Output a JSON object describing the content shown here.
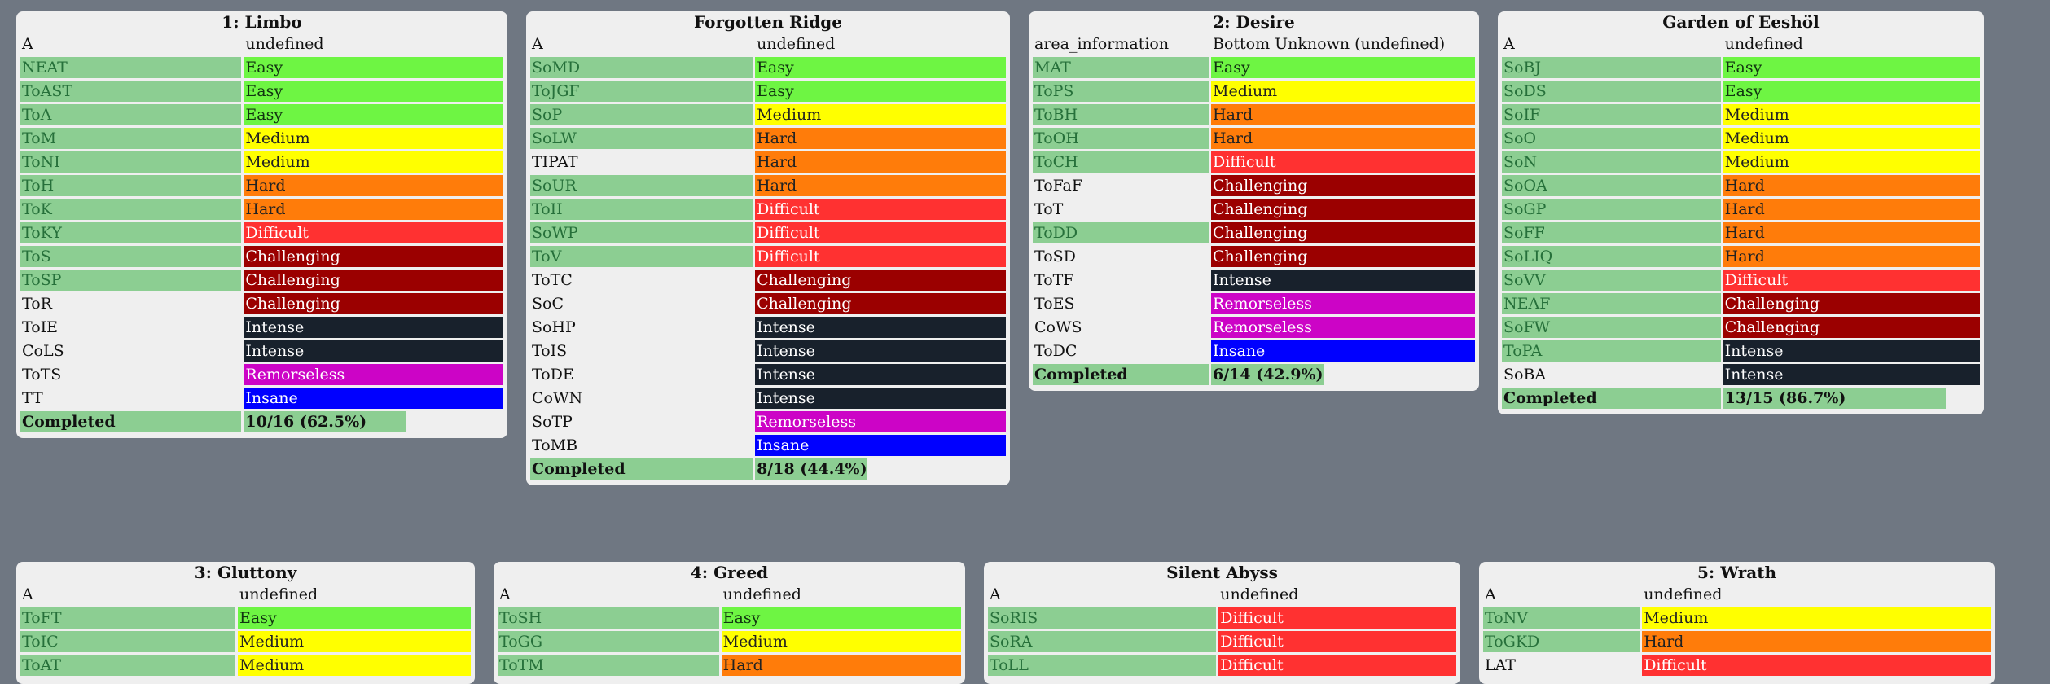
{
  "panels": [
    {
      "id": "limbo",
      "title": "1: Limbo",
      "header": [
        "A",
        "undefined"
      ],
      "rows": [
        {
          "name": "NEAT",
          "difficulty": "Easy",
          "done": true
        },
        {
          "name": "ToAST",
          "difficulty": "Easy",
          "done": true
        },
        {
          "name": "ToA",
          "difficulty": "Easy",
          "done": true
        },
        {
          "name": "ToM",
          "difficulty": "Medium",
          "done": true
        },
        {
          "name": "ToNI",
          "difficulty": "Medium",
          "done": true
        },
        {
          "name": "ToH",
          "difficulty": "Hard",
          "done": true
        },
        {
          "name": "ToK",
          "difficulty": "Hard",
          "done": true
        },
        {
          "name": "ToKY",
          "difficulty": "Difficult",
          "done": true
        },
        {
          "name": "ToS",
          "difficulty": "Challenging",
          "done": true
        },
        {
          "name": "ToSP",
          "difficulty": "Challenging",
          "done": true
        },
        {
          "name": "ToR",
          "difficulty": "Challenging",
          "done": false
        },
        {
          "name": "ToIE",
          "difficulty": "Intense",
          "done": false
        },
        {
          "name": "CoLS",
          "difficulty": "Intense",
          "done": false
        },
        {
          "name": "ToTS",
          "difficulty": "Remorseless",
          "done": false
        },
        {
          "name": "TT",
          "difficulty": "Insane",
          "done": false
        }
      ],
      "completed_label": "Completed",
      "completed_text": "10/16 (62.5%)",
      "completed_fraction": 0.625
    },
    {
      "id": "forgotten-ridge",
      "title": "Forgotten Ridge",
      "header": [
        "A",
        "undefined"
      ],
      "rows": [
        {
          "name": "SoMD",
          "difficulty": "Easy",
          "done": true
        },
        {
          "name": "ToJGF",
          "difficulty": "Easy",
          "done": true
        },
        {
          "name": "SoP",
          "difficulty": "Medium",
          "done": true
        },
        {
          "name": "SoLW",
          "difficulty": "Hard",
          "done": true
        },
        {
          "name": "TIPAT",
          "difficulty": "Hard",
          "done": false
        },
        {
          "name": "SoUR",
          "difficulty": "Hard",
          "done": true
        },
        {
          "name": "ToII",
          "difficulty": "Difficult",
          "done": true
        },
        {
          "name": "SoWP",
          "difficulty": "Difficult",
          "done": true
        },
        {
          "name": "ToV",
          "difficulty": "Difficult",
          "done": true
        },
        {
          "name": "ToTC",
          "difficulty": "Challenging",
          "done": false
        },
        {
          "name": "SoC",
          "difficulty": "Challenging",
          "done": false
        },
        {
          "name": "SoHP",
          "difficulty": "Intense",
          "done": false
        },
        {
          "name": "ToIS",
          "difficulty": "Intense",
          "done": false
        },
        {
          "name": "ToDE",
          "difficulty": "Intense",
          "done": false
        },
        {
          "name": "CoWN",
          "difficulty": "Intense",
          "done": false
        },
        {
          "name": "SoTP",
          "difficulty": "Remorseless",
          "done": false
        },
        {
          "name": "ToMB",
          "difficulty": "Insane",
          "done": false
        }
      ],
      "completed_label": "Completed",
      "completed_text": "8/18 (44.4%)",
      "completed_fraction": 0.444
    },
    {
      "id": "desire",
      "title": "2: Desire",
      "header": [
        "area_information",
        "Bottom Unknown (undefined)"
      ],
      "rows": [
        {
          "name": "MAT",
          "difficulty": "Easy",
          "done": true
        },
        {
          "name": "ToPS",
          "difficulty": "Medium",
          "done": true
        },
        {
          "name": "ToBH",
          "difficulty": "Hard",
          "done": true
        },
        {
          "name": "ToOH",
          "difficulty": "Hard",
          "done": true
        },
        {
          "name": "ToCH",
          "difficulty": "Difficult",
          "done": true
        },
        {
          "name": "ToFaF",
          "difficulty": "Challenging",
          "done": false
        },
        {
          "name": "ToT",
          "difficulty": "Challenging",
          "done": false
        },
        {
          "name": "ToDD",
          "difficulty": "Challenging",
          "done": true
        },
        {
          "name": "ToSD",
          "difficulty": "Challenging",
          "done": false
        },
        {
          "name": "ToTF",
          "difficulty": "Intense",
          "done": false
        },
        {
          "name": "ToES",
          "difficulty": "Remorseless",
          "done": false
        },
        {
          "name": "CoWS",
          "difficulty": "Remorseless",
          "done": false
        },
        {
          "name": "ToDC",
          "difficulty": "Insane",
          "done": false
        }
      ],
      "completed_label": "Completed",
      "completed_text": "6/14 (42.9%)",
      "completed_fraction": 0.429
    },
    {
      "id": "garden-of-eeshol",
      "title": "Garden of Eeshöl",
      "header": [
        "A",
        "undefined"
      ],
      "rows": [
        {
          "name": "SoBJ",
          "difficulty": "Easy",
          "done": true
        },
        {
          "name": "SoDS",
          "difficulty": "Easy",
          "done": true
        },
        {
          "name": "SoIF",
          "difficulty": "Medium",
          "done": true
        },
        {
          "name": "SoO",
          "difficulty": "Medium",
          "done": true
        },
        {
          "name": "SoN",
          "difficulty": "Medium",
          "done": true
        },
        {
          "name": "SoOA",
          "difficulty": "Hard",
          "done": true
        },
        {
          "name": "SoGP",
          "difficulty": "Hard",
          "done": true
        },
        {
          "name": "SoFF",
          "difficulty": "Hard",
          "done": true
        },
        {
          "name": "SoLIQ",
          "difficulty": "Hard",
          "done": true
        },
        {
          "name": "SoVV",
          "difficulty": "Difficult",
          "done": true
        },
        {
          "name": "NEAF",
          "difficulty": "Challenging",
          "done": true
        },
        {
          "name": "SoFW",
          "difficulty": "Challenging",
          "done": true
        },
        {
          "name": "ToPA",
          "difficulty": "Intense",
          "done": true
        },
        {
          "name": "SoBA",
          "difficulty": "Intense",
          "done": false
        }
      ],
      "completed_label": "Completed",
      "completed_text": "13/15 (86.7%)",
      "completed_fraction": 0.867
    },
    {
      "id": "gluttony",
      "title": "3: Gluttony",
      "header": [
        "A",
        "undefined"
      ],
      "rows": [
        {
          "name": "ToFT",
          "difficulty": "Easy",
          "done": true
        },
        {
          "name": "ToIC",
          "difficulty": "Medium",
          "done": true
        },
        {
          "name": "ToAT",
          "difficulty": "Medium",
          "done": true
        }
      ]
    },
    {
      "id": "greed",
      "title": "4: Greed",
      "header": [
        "A",
        "undefined"
      ],
      "rows": [
        {
          "name": "ToSH",
          "difficulty": "Easy",
          "done": true
        },
        {
          "name": "ToGG",
          "difficulty": "Medium",
          "done": true
        },
        {
          "name": "ToTM",
          "difficulty": "Hard",
          "done": true
        }
      ]
    },
    {
      "id": "silent-abyss",
      "title": "Silent Abyss",
      "header": [
        "A",
        "undefined"
      ],
      "rows": [
        {
          "name": "SoRIS",
          "difficulty": "Difficult",
          "done": true
        },
        {
          "name": "SoRA",
          "difficulty": "Difficult",
          "done": true
        },
        {
          "name": "ToLL",
          "difficulty": "Difficult",
          "done": true
        }
      ]
    },
    {
      "id": "wrath",
      "title": "5: Wrath",
      "header": [
        "A",
        "undefined"
      ],
      "rows": [
        {
          "name": "ToNV",
          "difficulty": "Medium",
          "done": true
        },
        {
          "name": "ToGKD",
          "difficulty": "Hard",
          "done": true
        },
        {
          "name": "LAT",
          "difficulty": "Difficult",
          "done": false
        }
      ]
    }
  ]
}
